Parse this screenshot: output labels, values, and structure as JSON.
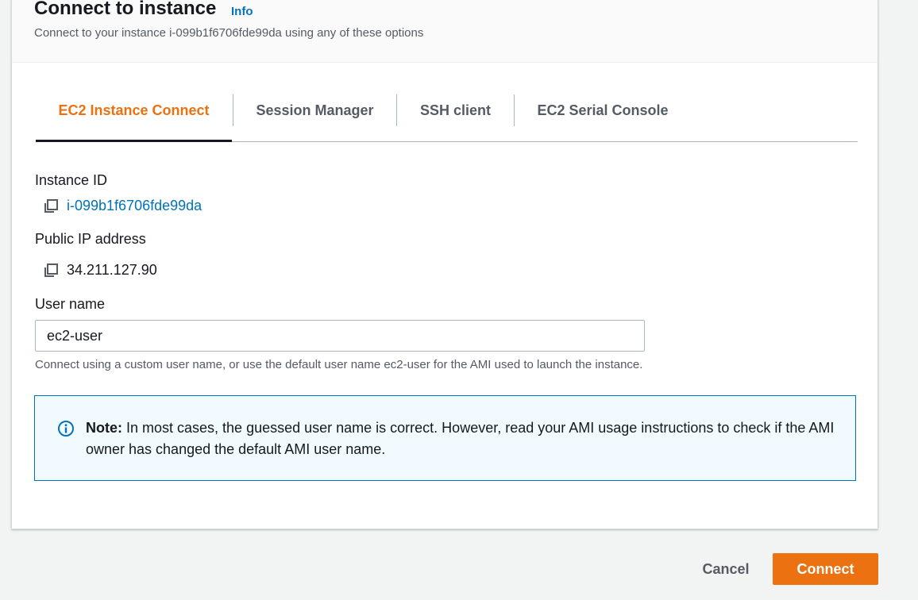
{
  "header": {
    "title": "Connect to instance",
    "info_label": "Info",
    "subtitle": "Connect to your instance i-099b1f6706fde99da using any of these options"
  },
  "tabs": [
    {
      "label": "EC2 Instance Connect",
      "active": true
    },
    {
      "label": "Session Manager",
      "active": false
    },
    {
      "label": "SSH client",
      "active": false
    },
    {
      "label": "EC2 Serial Console",
      "active": false
    }
  ],
  "instance": {
    "id_label": "Instance ID",
    "id_value": "i-099b1f6706fde99da",
    "ip_label": "Public IP address",
    "ip_value": "34.211.127.90"
  },
  "username": {
    "label": "User name",
    "value": "ec2-user",
    "hint": "Connect using a custom user name, or use the default user name ec2-user for the AMI used to launch the instance."
  },
  "note": {
    "prefix": "Note:",
    "text": " In most cases, the guessed user name is correct. However, read your AMI usage instructions to check if the AMI owner has changed the default AMI user name."
  },
  "footer": {
    "cancel_label": "Cancel",
    "connect_label": "Connect"
  },
  "colors": {
    "accent": "#ec7211",
    "link": "#0073bb",
    "info_bg": "#f1faff"
  },
  "icons": {
    "copy": "copy-icon",
    "info": "info-circle-icon"
  }
}
